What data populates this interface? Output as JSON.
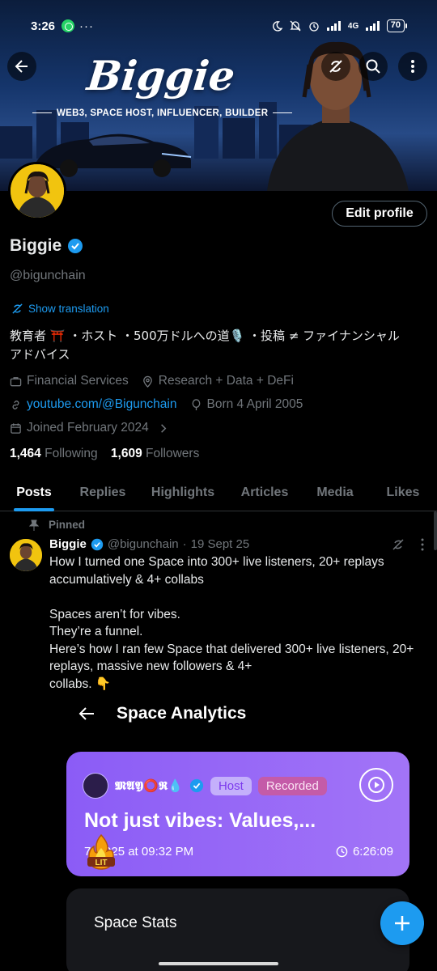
{
  "status": {
    "time": "3:26",
    "network": "4G",
    "battery": "70"
  },
  "banner": {
    "title": "Biggie",
    "subtitle": "WEB3, SPACE HOST, INFLUENCER, BUILDER"
  },
  "profile": {
    "edit_label": "Edit profile",
    "name": "Biggie",
    "handle": "@bigunchain",
    "show_translation": "Show translation",
    "bio_line1": "教育者 ⛩️ ・ホスト ・500万ドルへの道🎙️ ・投稿 ≠ ファイナンシャル",
    "bio_line2": "アドバイス",
    "category": "Financial Services",
    "location": "Research + Data + DeFi",
    "website": "youtube.com/@Bigunchain",
    "born": "Born 4 April 2005",
    "joined": "Joined February 2024",
    "following_count": "1,464",
    "following_label": "Following",
    "followers_count": "1,609",
    "followers_label": "Followers"
  },
  "tabs": [
    "Posts",
    "Replies",
    "Highlights",
    "Articles",
    "Media",
    "Likes"
  ],
  "pinned_label": "Pinned",
  "tweet": {
    "name": "Biggie",
    "handle": "@bigunchain",
    "sep": "·",
    "date": "19 Sept 25",
    "text": "How I turned one Space into 300+ live listeners, 20+ replays accumulatively & 4+ collabs\n\nSpaces aren’t for vibes.\nThey’re a funnel.\nHere’s how I ran few Space that delivered 300+ live listeners, 20+ replays, massive new followers & 4+\ncollabs. 👇"
  },
  "analytics": {
    "header": "Space Analytics",
    "host_name": "𝕸𝕬𝖄⭕𝕽💧",
    "host_pill": "Host",
    "recorded_pill": "Recorded",
    "space_title": "Not just vibes: Values,...",
    "date": "7, 2025 at 09:32 PM",
    "duration": "6:26:09",
    "lit": "LIT",
    "stats_title": "Space Stats"
  },
  "colors": {
    "accent": "#1d9bf0",
    "card": "#8b5cf6",
    "avatar_bg": "#f1c40f"
  }
}
